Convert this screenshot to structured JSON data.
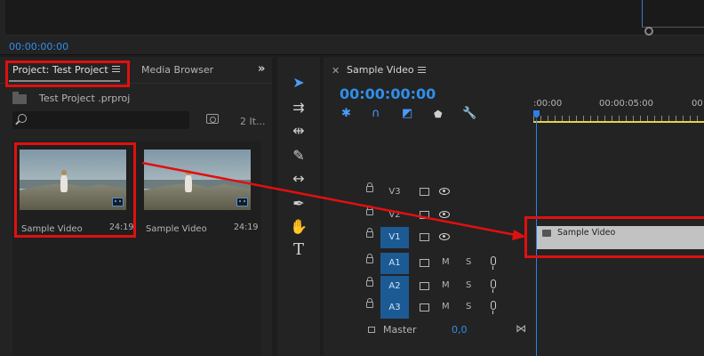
{
  "monitor": {
    "timecode": "00:00:00:00"
  },
  "project_panel": {
    "tab_active": "Project: Test Project",
    "tab_media": "Media Browser",
    "file_name": "Test Project .prproj",
    "search_placeholder": "",
    "item_count": "2 It...",
    "clips": [
      {
        "name": "Sample Video",
        "duration": "24:19"
      },
      {
        "name": "Sample Video",
        "duration": "24:19"
      }
    ]
  },
  "timeline_panel": {
    "sequence_name": "Sample Video",
    "timecode": "00:00:00:00",
    "ruler_labels": [
      ":00:00",
      "00:00:05:00",
      "00"
    ],
    "video_tracks": [
      "V3",
      "V2",
      "V1"
    ],
    "audio_tracks": [
      "A1",
      "A2",
      "A3"
    ],
    "track_m": "M",
    "track_s": "S",
    "master_label": "Master",
    "master_value": "0,0",
    "clip_name": "Sample Video",
    "clip_fx": "fx"
  },
  "icons": {
    "selection": "arrow-icon",
    "track_select": "track-select-icon",
    "ripple": "ripple-edit-icon",
    "razor": "razor-icon",
    "slip": "slip-icon",
    "pen": "pen-icon",
    "hand": "hand-icon",
    "type": "T"
  },
  "colors": {
    "accent": "#2f8fe8",
    "highlight": "#e01010",
    "track_on": "#1c5a94",
    "clip_gray": "#c2c2c2"
  }
}
